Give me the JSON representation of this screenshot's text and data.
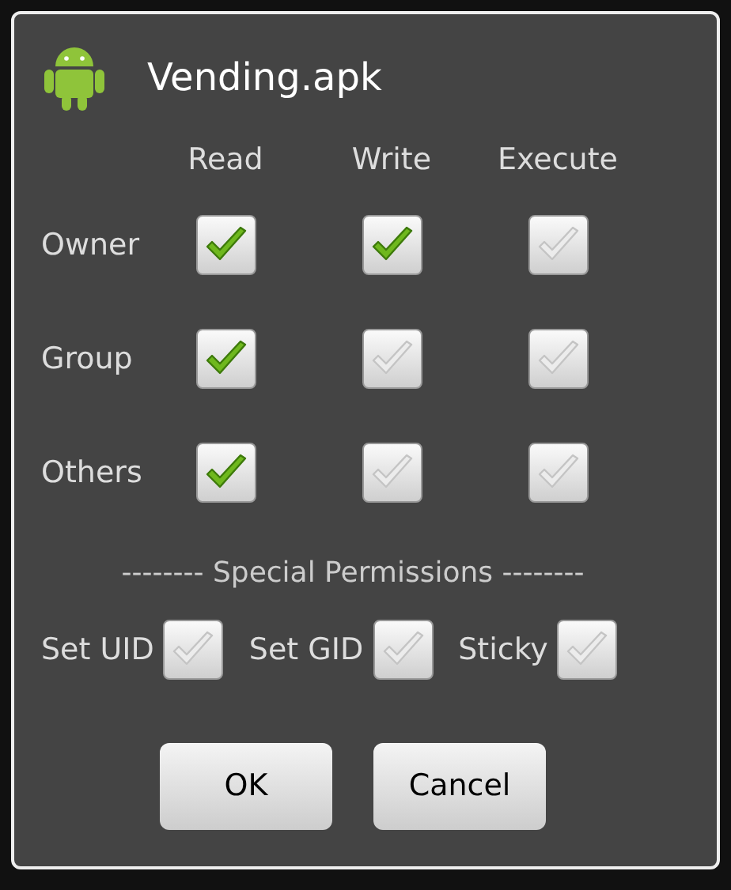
{
  "dialog": {
    "title": "Vending.apk",
    "columns": [
      "Read",
      "Write",
      "Execute"
    ],
    "rows": [
      {
        "label": "Owner",
        "checks": [
          {
            "checked": true
          },
          {
            "checked": true
          },
          {
            "checked": false
          }
        ]
      },
      {
        "label": "Group",
        "checks": [
          {
            "checked": true
          },
          {
            "checked": false
          },
          {
            "checked": false
          }
        ]
      },
      {
        "label": "Others",
        "checks": [
          {
            "checked": true
          },
          {
            "checked": false
          },
          {
            "checked": false
          }
        ]
      }
    ],
    "special_heading": "-------- Special Permissions --------",
    "special": [
      {
        "label": "Set UID",
        "checked": false
      },
      {
        "label": "Set GID",
        "checked": false
      },
      {
        "label": "Sticky",
        "checked": false
      }
    ],
    "buttons": [
      "OK",
      "Cancel"
    ]
  }
}
